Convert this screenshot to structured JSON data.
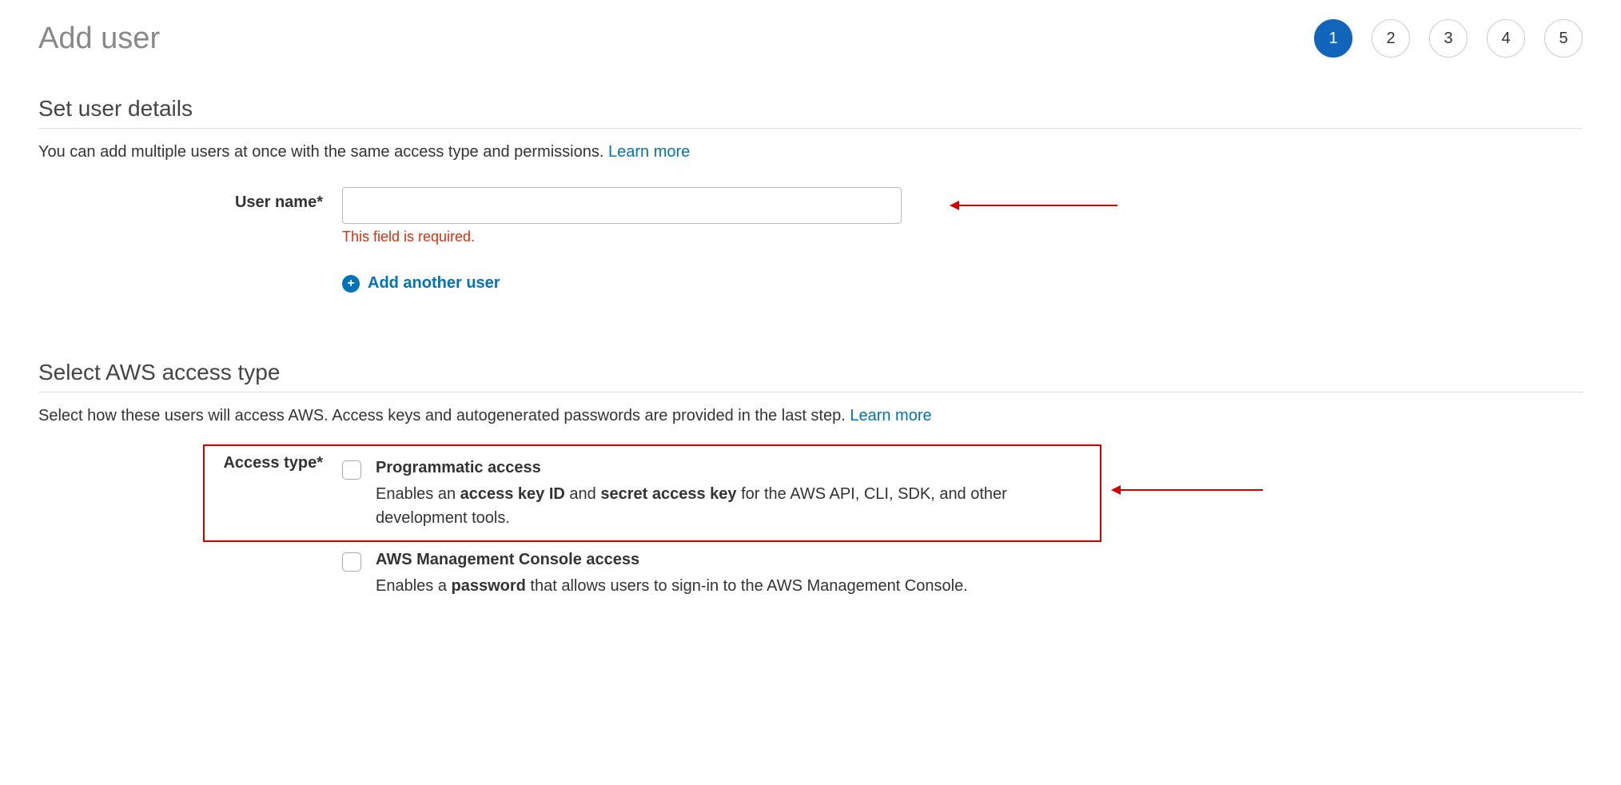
{
  "page": {
    "title": "Add user"
  },
  "steps": {
    "items": [
      "1",
      "2",
      "3",
      "4",
      "5"
    ],
    "active_index": 0
  },
  "section_user_details": {
    "title": "Set user details",
    "description_prefix": "You can add multiple users at once with the same access type and permissions. ",
    "learn_more": "Learn more",
    "username_label": "User name*",
    "username_value": "",
    "username_error": "This field is required.",
    "add_another_label": "Add another user"
  },
  "section_access_type": {
    "title": "Select AWS access type",
    "description_prefix": "Select how these users will access AWS. Access keys and autogenerated passwords are provided in the last step. ",
    "learn_more": "Learn more",
    "access_type_label": "Access type*",
    "options": [
      {
        "title": "Programmatic access",
        "desc_pre": "Enables an ",
        "desc_b1": "access key ID",
        "desc_mid": " and ",
        "desc_b2": "secret access key",
        "desc_post": " for the AWS API, CLI, SDK, and other development tools."
      },
      {
        "title": "AWS Management Console access",
        "desc_pre": "Enables a ",
        "desc_b1": "password",
        "desc_mid": "",
        "desc_b2": "",
        "desc_post": " that allows users to sign-in to the AWS Management Console."
      }
    ]
  },
  "annotations": {
    "highlight_programmatic": true,
    "arrow_username": true,
    "arrow_programmatic": true
  }
}
